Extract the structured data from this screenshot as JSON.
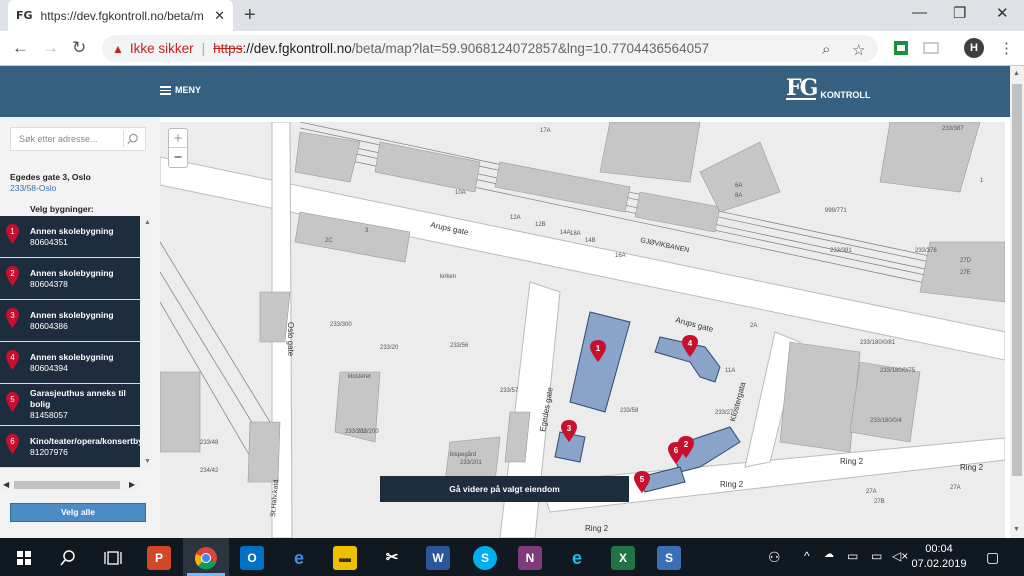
{
  "browser": {
    "tab_favicon": "FG",
    "tab_title": "https://dev.fgkontroll.no/beta/m",
    "tab_close": "✕",
    "new_tab": "+",
    "window_controls": [
      "—",
      "❐",
      "✕"
    ],
    "security_label": "Ikke sikker",
    "url_scheme": "https",
    "url_host": "://dev.fgkontroll.no",
    "url_rest": "/beta/map?lat=59.9068124072857&lng=10.7704436564057",
    "avatar_letter": "H"
  },
  "app": {
    "menu_label": "MENY",
    "logo_mark": "FG",
    "logo_text": "KONTROLL"
  },
  "sidebar": {
    "search_placeholder": "Søk etter adresse...",
    "address_title": "Egedes gate 3, Oslo",
    "address_sub": "233/58-Oslo",
    "select_label": "Velg bygninger:",
    "buildings": [
      {
        "n": "1",
        "name": "Annen skolebygning",
        "num": "80604351"
      },
      {
        "n": "2",
        "name": "Annen skolebygning",
        "num": "80604378"
      },
      {
        "n": "3",
        "name": "Annen skolebygning",
        "num": "80604386"
      },
      {
        "n": "4",
        "name": "Annen skolebygning",
        "num": "80604394"
      },
      {
        "n": "5",
        "name": "Garasjeuthus anneks til",
        "name2": "bolig",
        "num": "81458057"
      },
      {
        "n": "6",
        "name": "Kino/teater/opera/konsertbyg",
        "num": "81207976"
      }
    ],
    "select_all": "Velg alle",
    "pin_color": "#c8102e"
  },
  "map": {
    "goto_button": "Gå videre på valgt eiendom",
    "zoom_in": "+",
    "zoom_out": "−",
    "streets": [
      "Arups gate",
      "Arups gate",
      "Oslo gate",
      "Egedes gate",
      "Klostergata",
      "Ring 2",
      "Ring 2",
      "Ring 2",
      "Ring 2",
      "GJØVIKBANEN",
      "St.Halv.katd."
    ],
    "labels": [
      "233/58",
      "233/57",
      "233/56",
      "233/27",
      "233/20",
      "233/300",
      "233/200",
      "233/201",
      "233/202",
      "233/387",
      "233/1",
      "233/46",
      "233/48",
      "234/42",
      "klosteret",
      "kirken",
      "bispegård",
      "27A",
      "27B",
      "27D",
      "27E",
      "16A",
      "18A",
      "10A",
      "12A",
      "12B",
      "14A",
      "14B",
      "2A",
      "2C",
      "11A",
      "17A",
      "6A",
      "8A",
      "3",
      "1",
      "27A",
      "999/771",
      "233/381",
      "233/376",
      "233/180/0/81",
      "233/180/0/75",
      "233/180/0/4"
    ],
    "pins": [
      "1",
      "2",
      "3",
      "4",
      "5",
      "6"
    ],
    "building_fill": "#8aa3c8"
  },
  "taskbar": {
    "time": "00:04",
    "date": "07.02.2019"
  }
}
